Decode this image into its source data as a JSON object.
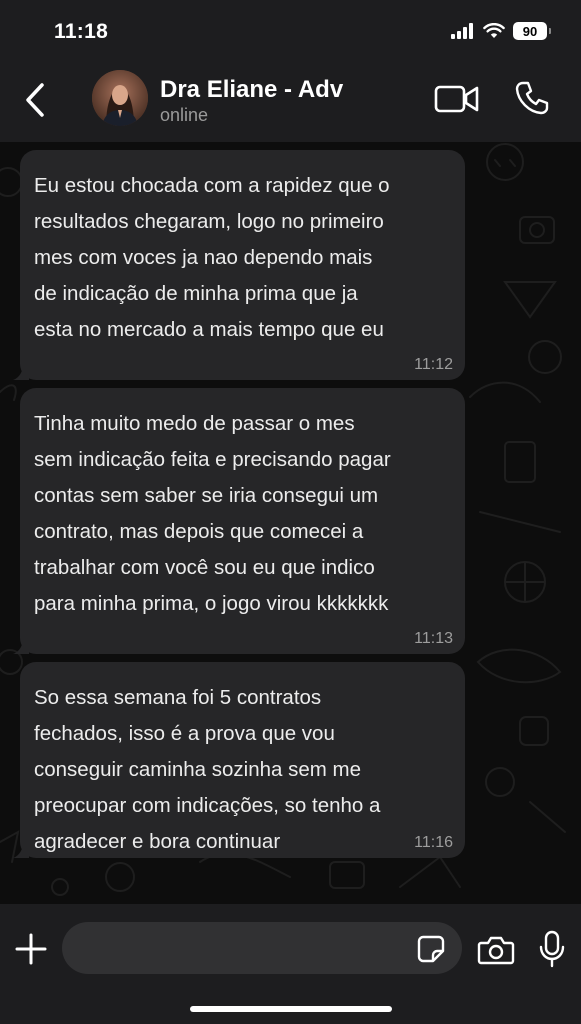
{
  "status_bar": {
    "time": "11:18",
    "battery": "90",
    "icons": [
      "signal-icon",
      "wifi-icon",
      "battery-icon"
    ]
  },
  "header": {
    "contact_name": "Dra Eliane - Adv",
    "contact_status": "online",
    "icons": [
      "back-chevron-icon",
      "video-call-icon",
      "phone-call-icon"
    ]
  },
  "messages": [
    {
      "text": "Eu estou chocada com a rapidez que o\nresultados chegaram, logo no primeiro\nmes com voces ja nao dependo mais\nde indicação de minha prima que ja\nesta no mercado a mais tempo que eu",
      "time": "11:12"
    },
    {
      "text": "Tinha muito medo de passar o mes\nsem indicação feita e precisando pagar\ncontas sem saber se iria consegui um\ncontrato, mas depois que comecei a\ntrabalhar com você sou eu que indico\npara minha prima, o jogo virou kkkkkkk",
      "time": "11:13"
    },
    {
      "text": "So essa semana foi 5 contratos\nfechados, isso é a prova que vou\nconseguir caminha sozinha sem me\npreocupar com indicações, so tenho a\nagradecer e bora continuar",
      "time": "11:16"
    }
  ],
  "input_bar": {
    "placeholder": "",
    "icons": [
      "plus-icon",
      "sticker-icon",
      "camera-icon",
      "microphone-icon"
    ]
  },
  "colors": {
    "bar_background": "#1d1d1f",
    "chat_background": "#0d0d0d",
    "bubble_background": "#262628",
    "text_primary": "#ececec",
    "text_secondary": "#9d9d9d"
  }
}
